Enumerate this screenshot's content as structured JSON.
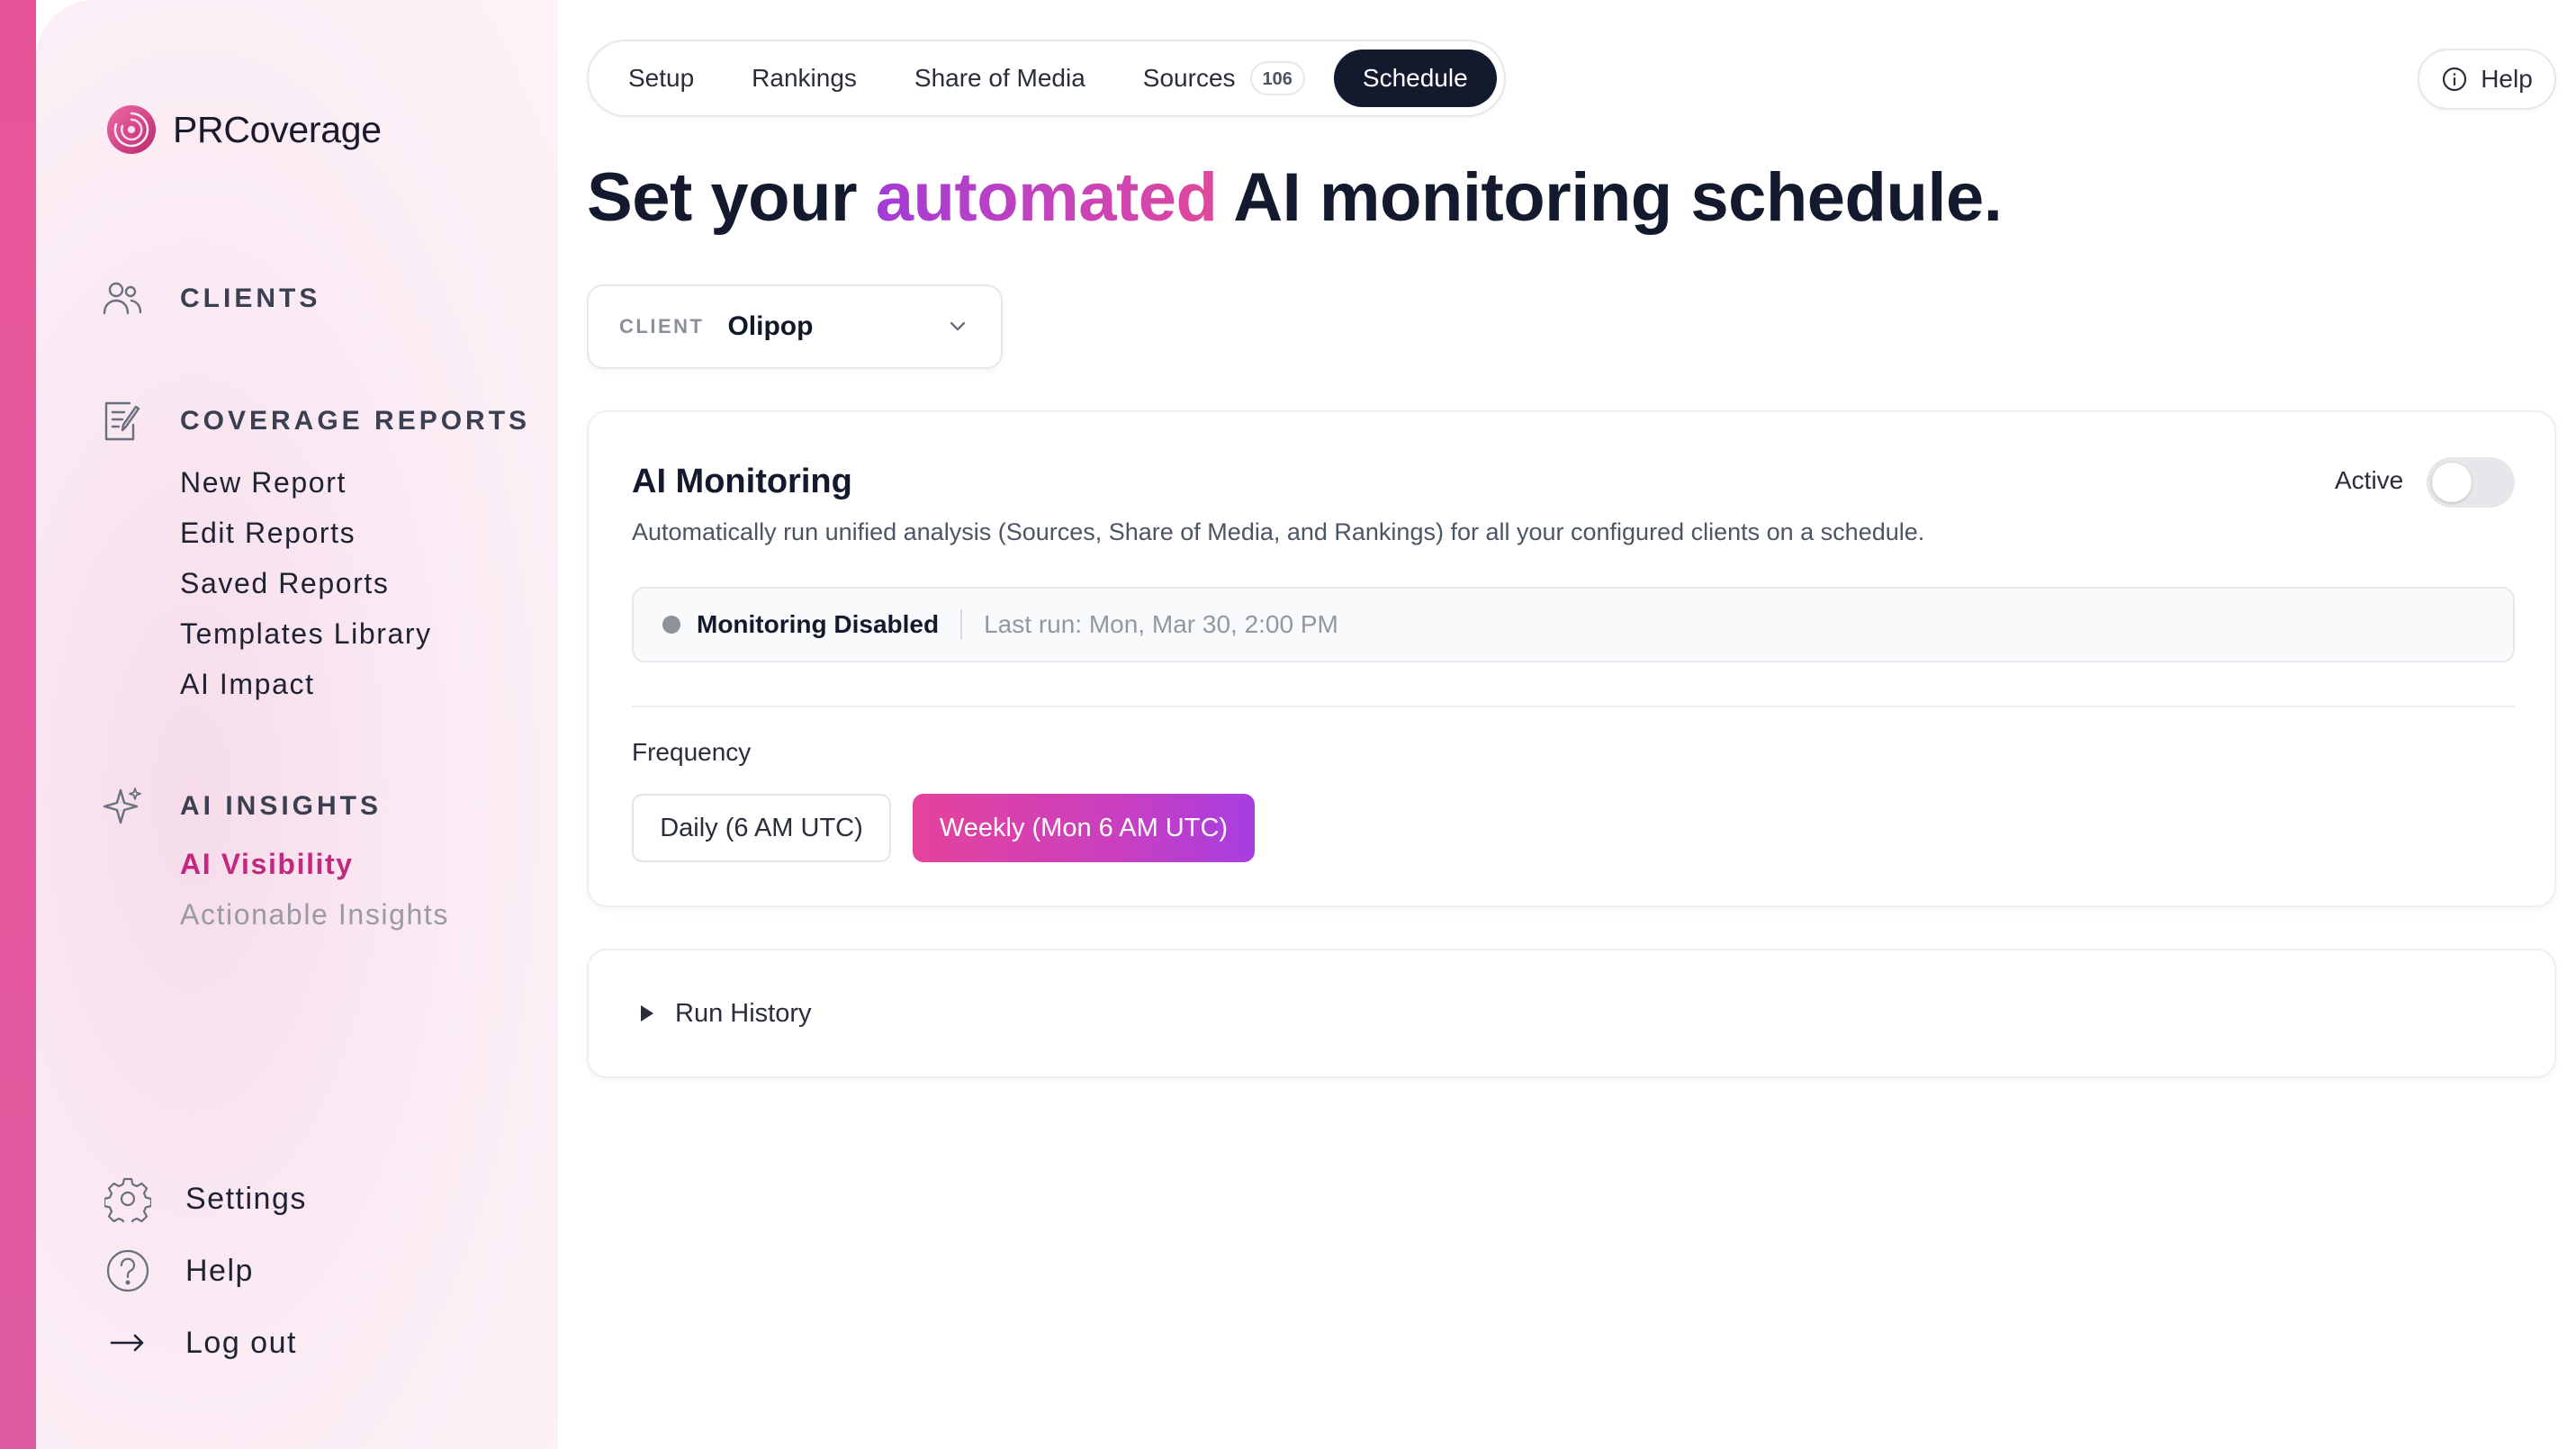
{
  "app": {
    "brand": "PRCoverage"
  },
  "sidebar": {
    "clients": {
      "label": "CLIENTS",
      "icon": "users-icon"
    },
    "coverage_reports": {
      "label": "COVERAGE REPORTS",
      "icon": "report-edit-icon",
      "items": [
        {
          "label": "New Report"
        },
        {
          "label": "Edit Reports"
        },
        {
          "label": "Saved Reports"
        },
        {
          "label": "Templates Library"
        },
        {
          "label": "AI Impact"
        }
      ]
    },
    "ai_insights": {
      "label": "AI INSIGHTS",
      "icon": "sparkle-icon",
      "items": [
        {
          "label": "AI Visibility",
          "state": "active"
        },
        {
          "label": "Actionable Insights",
          "state": "muted"
        }
      ]
    },
    "bottom": [
      {
        "label": "Settings",
        "icon": "gear-icon"
      },
      {
        "label": "Help",
        "icon": "question-circle-icon"
      },
      {
        "label": "Log out",
        "icon": "arrow-right-icon"
      }
    ]
  },
  "tabs": [
    {
      "label": "Setup"
    },
    {
      "label": "Rankings"
    },
    {
      "label": "Share of Media"
    },
    {
      "label": "Sources",
      "badge": "106"
    },
    {
      "label": "Schedule",
      "active": true
    }
  ],
  "help_button": {
    "label": "Help",
    "icon": "info-circle-icon"
  },
  "headline": {
    "before": "Set your ",
    "accent": "automated",
    "after": " AI monitoring schedule."
  },
  "client_selector": {
    "label": "CLIENT",
    "value": "Olipop",
    "icon": "chevron-down-icon"
  },
  "monitoring": {
    "title": "AI Monitoring",
    "description": "Automatically run unified analysis (Sources, Share of Media, and Rankings) for all your configured clients on a schedule.",
    "active_label": "Active",
    "active": false,
    "status": "Monitoring Disabled",
    "last_run": "Last run: Mon, Mar 30, 2:00 PM",
    "frequency_label": "Frequency",
    "frequency_options": [
      {
        "label": "Daily (6 AM UTC)",
        "selected": false
      },
      {
        "label": "Weekly (Mon 6 AM UTC)",
        "selected": true
      }
    ]
  },
  "run_history": {
    "label": "Run History",
    "icon": "triangle-right-icon"
  },
  "colors": {
    "accent_pink": "#e0489b",
    "accent_purple": "#a33bd6",
    "active_nav": "#c2287e",
    "dark": "#141a2e"
  }
}
